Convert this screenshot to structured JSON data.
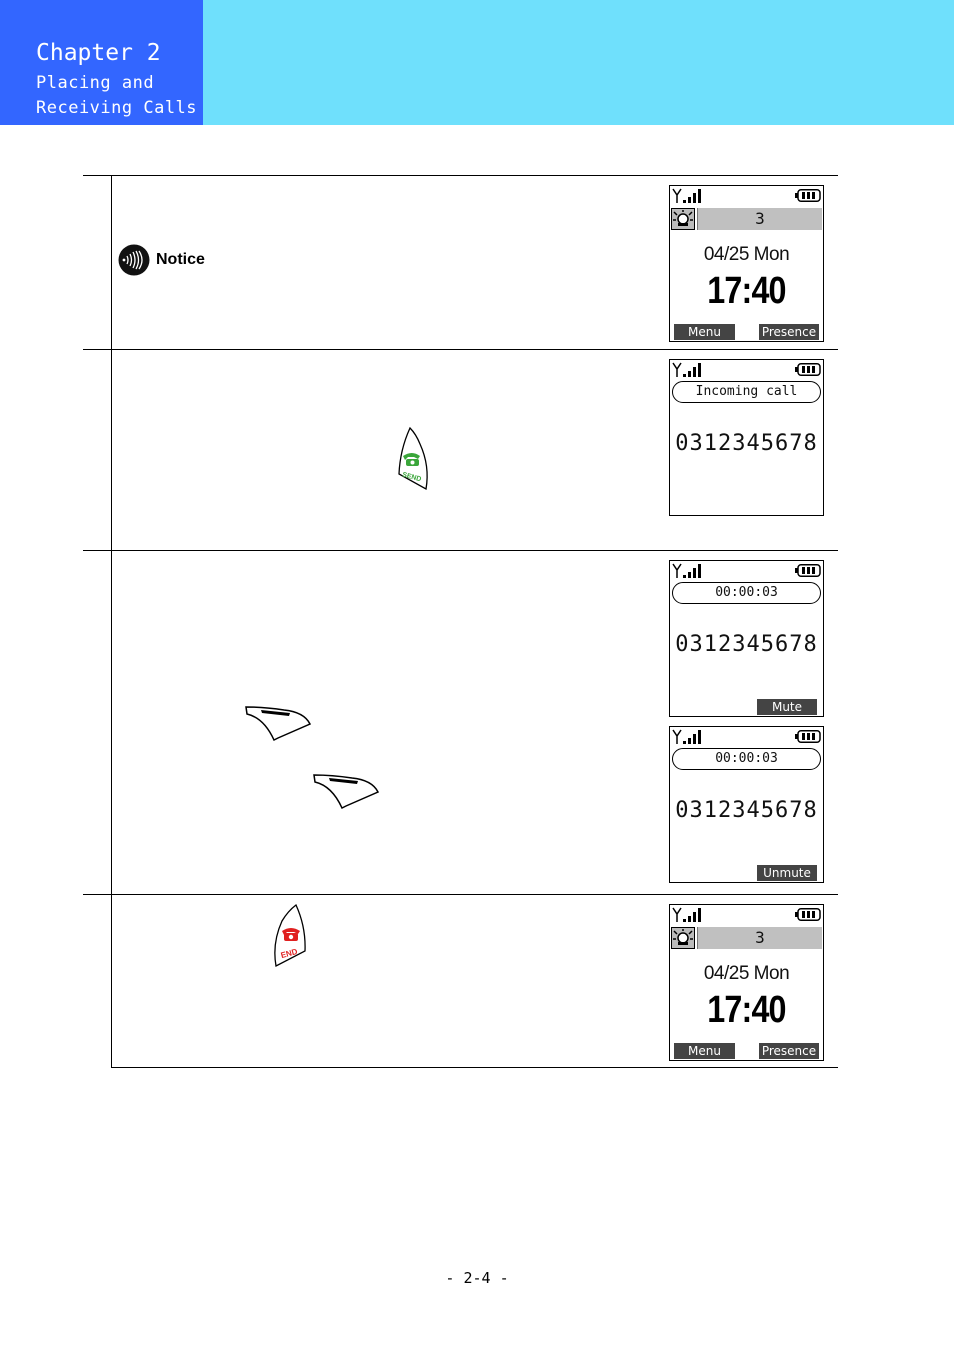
{
  "header": {
    "chapter_title": "Chapter 2",
    "chapter_subtitle_line1": "Placing and",
    "chapter_subtitle_line2": "Receiving Calls",
    "colors": {
      "chapter_box": "#3366ff",
      "band": "#6fe0fc"
    }
  },
  "notice": {
    "label": "Notice"
  },
  "screens": {
    "standby_1": {
      "badge_count": "3",
      "date": "04/25 Mon",
      "time": "17:40",
      "softkey_left": "Menu",
      "softkey_right": "Presence"
    },
    "incoming": {
      "status_text": "Incoming call",
      "number": "0312345678"
    },
    "in_call_mute": {
      "timer": "00:00:03",
      "number": "0312345678",
      "softkey_right": "Mute"
    },
    "in_call_unmute": {
      "timer": "00:00:03",
      "number": "0312345678",
      "softkey_right": "Unmute"
    },
    "standby_2": {
      "badge_count": "3",
      "date": "04/25 Mon",
      "time": "17:40",
      "softkey_left": "Menu",
      "softkey_right": "Presence"
    }
  },
  "keys": {
    "send_key": {
      "label": "SEND",
      "color": "#3aa63a"
    },
    "end_key": {
      "label": "END",
      "color": "#e02020"
    },
    "softkey_icons": [
      "right-softkey-icon",
      "right-softkey-icon"
    ]
  },
  "footer": {
    "page_number": "- 2-4 -"
  }
}
